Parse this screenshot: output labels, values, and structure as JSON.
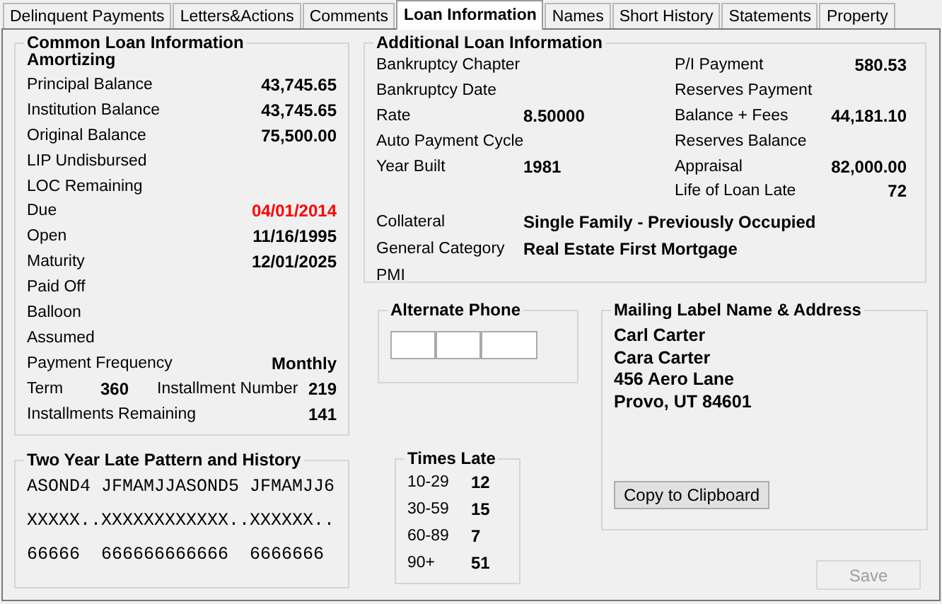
{
  "tabs": [
    {
      "label": "Delinquent Payments",
      "selected": false
    },
    {
      "label": "Letters&Actions",
      "selected": false
    },
    {
      "label": "Comments",
      "selected": false
    },
    {
      "label": "Loan Information",
      "selected": true
    },
    {
      "label": "Names",
      "selected": false
    },
    {
      "label": "Short History",
      "selected": false
    },
    {
      "label": "Statements",
      "selected": false
    },
    {
      "label": "Property",
      "selected": false
    }
  ],
  "common_loan_information": {
    "title": "Common Loan Information",
    "subtitle": "Amortizing",
    "rows": [
      {
        "kind": "field",
        "label": "Principal Balance",
        "value": "43,745.65"
      },
      {
        "kind": "field",
        "label": "Institution Balance",
        "value": "43,745.65"
      },
      {
        "kind": "field",
        "label": "Original Balance",
        "value": "75,500.00"
      },
      {
        "kind": "field",
        "label": "LIP Undisbursed"
      },
      {
        "kind": "field",
        "label": "LOC Remaining"
      },
      {
        "kind": "alert",
        "label": "Due",
        "value": "04/01/2014"
      },
      {
        "kind": "field",
        "label": "Open",
        "value": "11/16/1995"
      },
      {
        "kind": "field",
        "label": "Maturity",
        "value": "12/01/2025"
      },
      {
        "kind": "field",
        "label": "Paid Off"
      },
      {
        "kind": "field",
        "label": "Balloon"
      },
      {
        "kind": "field",
        "label": "Assumed"
      },
      {
        "kind": "field",
        "label": "Payment Frequency",
        "value": "Monthly"
      },
      {
        "kind": "pair",
        "label": "Term",
        "value": "360",
        "label_2": "Installment Number",
        "value_2": "219"
      },
      {
        "kind": "field",
        "label": "Installments Remaining",
        "value": "141"
      }
    ]
  },
  "additional_loan_information": {
    "title": "Additional Loan Information",
    "left": [
      {
        "label": "Bankruptcy Chapter"
      },
      {
        "label": "Bankruptcy Date"
      },
      {
        "label": "Rate",
        "value": "8.50000"
      },
      {
        "label": "Auto Payment Cycle"
      },
      {
        "label": "Year Built",
        "value": "1981"
      }
    ],
    "right": [
      {
        "label": "P/I Payment",
        "value": "580.53"
      },
      {
        "label": "Reserves Payment"
      },
      {
        "label": "Balance + Fees",
        "value": "44,181.10"
      },
      {
        "label": "Reserves Balance"
      },
      {
        "label": "Appraisal",
        "value": "82,000.00"
      },
      {
        "label": "Life of Loan Late",
        "value": "72"
      }
    ],
    "details": [
      {
        "label": "Collateral",
        "value": "Single Family - Previously Occupied"
      },
      {
        "label": "General Category",
        "value": "Real Estate First Mortgage"
      },
      {
        "label": "PMI"
      }
    ]
  },
  "alternate_phone": {
    "title": "Alternate Phone"
  },
  "late_pattern": {
    "title": "Two Year Late Pattern and History",
    "lines": [
      "ASOND4 JFMAMJJASOND5 JFMAMJJ6",
      "XXXXX..XXXXXXXXXXXX..XXXXXX..",
      "66666  666666666666  6666666"
    ]
  },
  "times_late": {
    "title": "Times Late",
    "rows": [
      {
        "label": "10-29",
        "value": "12"
      },
      {
        "label": "30-59",
        "value": "15"
      },
      {
        "label": "60-89",
        "value": "7"
      },
      {
        "label": "90+",
        "value": "51"
      }
    ]
  },
  "mailing_label": {
    "title": "Mailing Label Name & Address",
    "lines": [
      "Carl Carter",
      "Cara Carter",
      "456 Aero Lane",
      "Provo, UT  84601"
    ],
    "button": "Copy to Clipboard"
  },
  "save_button": {
    "label": "Save",
    "disabled": true
  }
}
